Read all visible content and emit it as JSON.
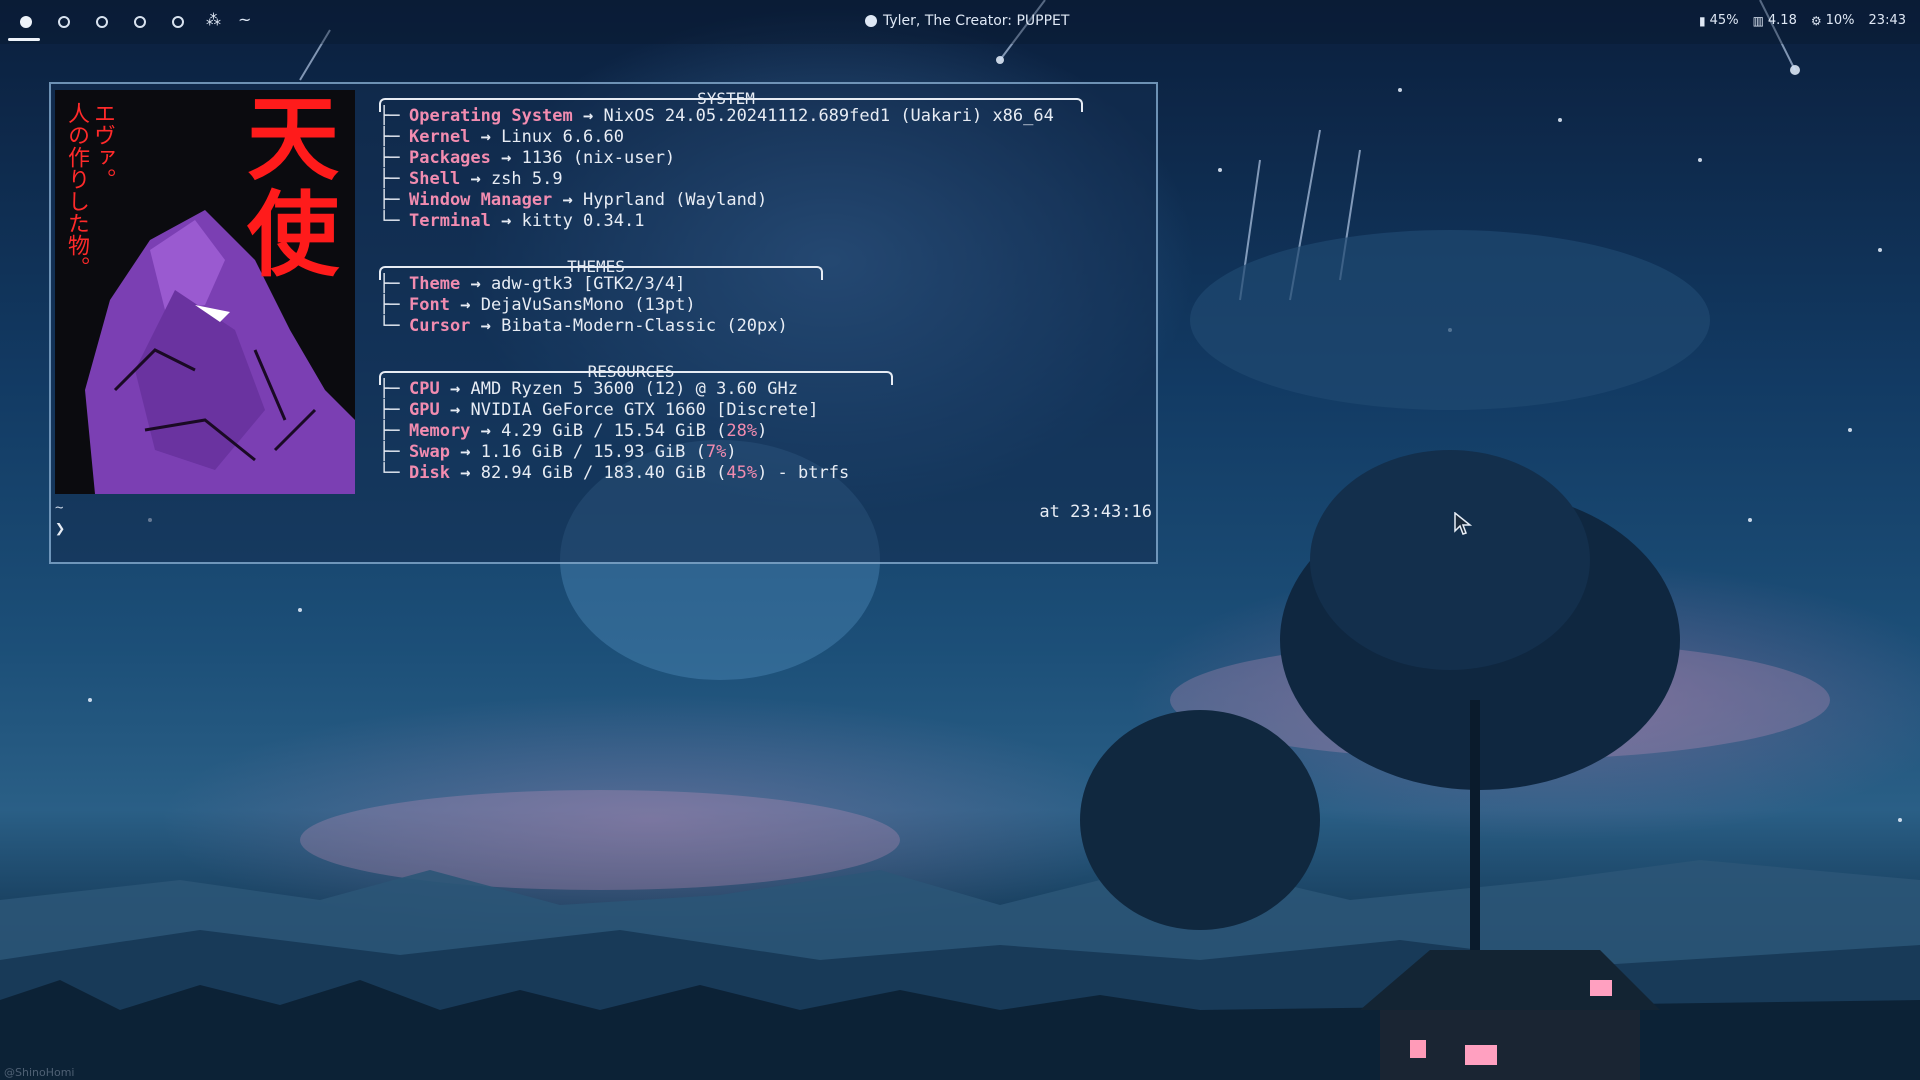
{
  "topbar": {
    "workspaces": [
      {
        "icon": "filled-circle-icon",
        "active": true
      },
      {
        "icon": "ring-circle-icon",
        "active": false
      },
      {
        "icon": "ring-circle-icon",
        "active": false
      },
      {
        "icon": "ring-circle-icon",
        "active": false
      },
      {
        "icon": "ring-circle-icon",
        "active": false
      }
    ],
    "app_glyph": "⁂",
    "tilde": "~",
    "media": {
      "icon": "spotify-icon",
      "text": "Tyler, The Creator: PUPPET"
    },
    "status": {
      "battery": "45%",
      "load": "4.18",
      "cpu": "10%",
      "clock": "23:43"
    }
  },
  "terminal": {
    "art": {
      "kanji": "天使",
      "vertical_text": [
        "エヴァ。",
        "人の作りした物。"
      ]
    },
    "sections": {
      "system": {
        "title": "SYSTEM",
        "rows": [
          {
            "key": "Operating System",
            "value": "NixOS 24.05.20241112.689fed1 (Uakari) x86_64"
          },
          {
            "key": "Kernel",
            "value": "Linux 6.6.60"
          },
          {
            "key": "Packages",
            "value": "1136 (nix-user)"
          },
          {
            "key": "Shell",
            "value": "zsh 5.9"
          },
          {
            "key": "Window Manager",
            "value": "Hyprland (Wayland)"
          },
          {
            "key": "Terminal",
            "value": "kitty 0.34.1"
          }
        ]
      },
      "themes": {
        "title": "THEMES",
        "rows": [
          {
            "key": "Theme",
            "value": "adw-gtk3 [GTK2/3/4]"
          },
          {
            "key": "Font",
            "value": "DejaVuSansMono (13pt)"
          },
          {
            "key": "Cursor",
            "value": "Bibata-Modern-Classic (20px)"
          }
        ]
      },
      "resources": {
        "title": "RESOURCES",
        "rows": [
          {
            "key": "CPU",
            "value": "AMD Ryzen 5 3600 (12) @ 3.60 GHz"
          },
          {
            "key": "GPU",
            "value": "NVIDIA GeForce GTX 1660 [Discrete]"
          },
          {
            "key": "Memory",
            "value": "4.29 GiB / 15.54 GiB (",
            "pct": "28%",
            "tail": ")"
          },
          {
            "key": "Swap",
            "value": "1.16 GiB / 15.93 GiB (",
            "pct": "7%",
            "tail": ")"
          },
          {
            "key": "Disk",
            "value": "82.94 GiB / 183.40 GiB (",
            "pct": "45%",
            "tail": ") - btrfs"
          }
        ]
      }
    },
    "prompt_dir": "~",
    "prompt_symbol": "❯",
    "timestamp": "at 23:43:16",
    "arrow": "→"
  },
  "watermark": "@ShinoHomi",
  "colors": {
    "accent": "#f28cb0",
    "text": "#e7ecf4",
    "kanji": "#ff1b1b",
    "mecha": "#7b3fb3"
  }
}
